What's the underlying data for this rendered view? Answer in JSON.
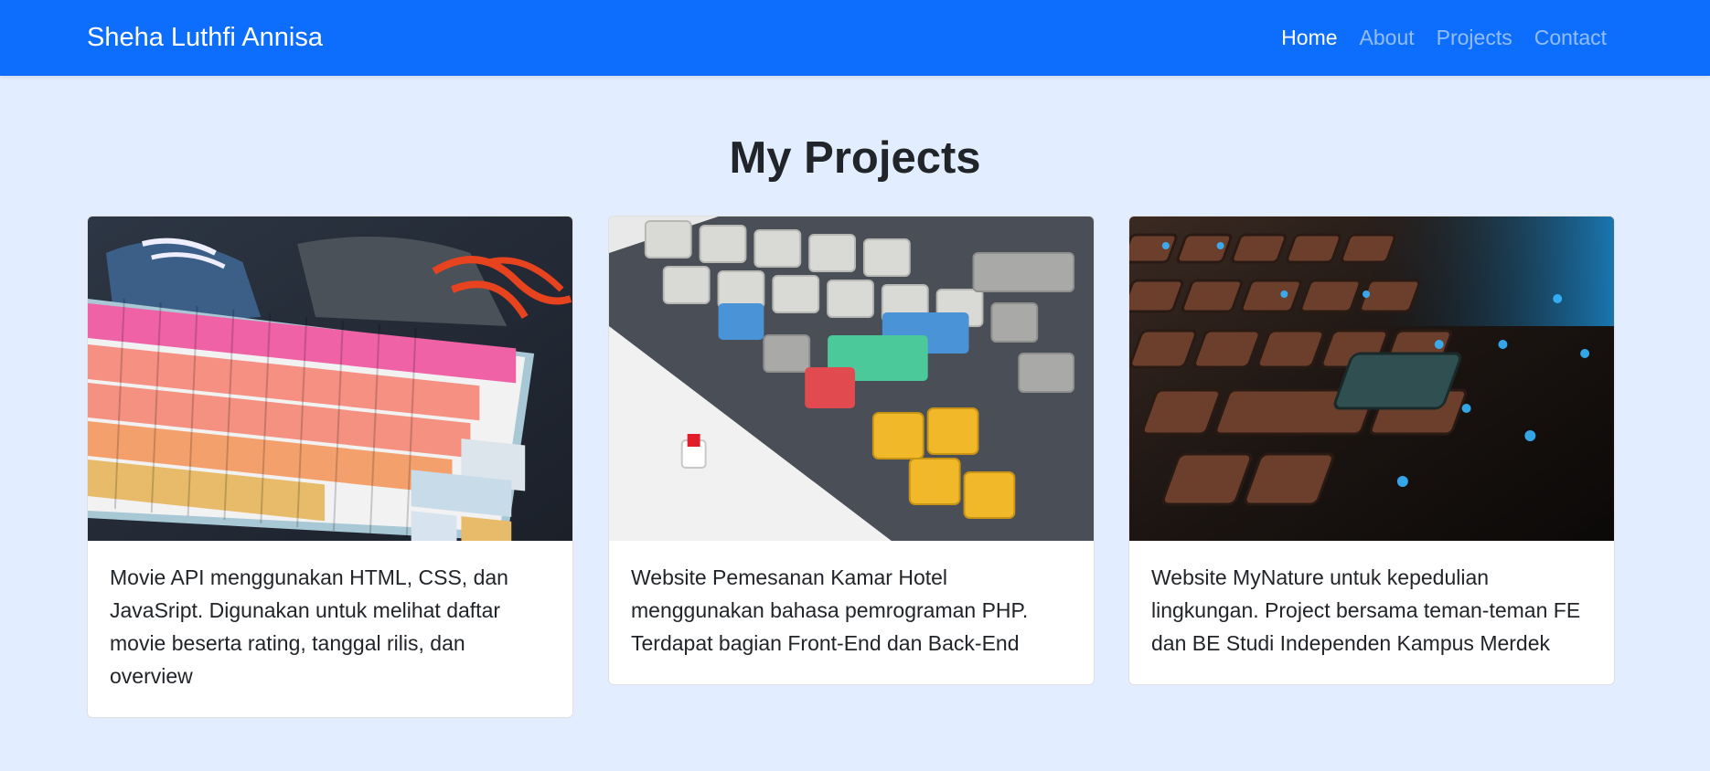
{
  "navbar": {
    "brand": "Sheha Luthfi Annisa",
    "links": [
      {
        "label": "Home",
        "active": true
      },
      {
        "label": "About",
        "active": false
      },
      {
        "label": "Projects",
        "active": false
      },
      {
        "label": "Contact",
        "active": false
      }
    ]
  },
  "main": {
    "title": "My Projects",
    "projects": [
      {
        "image": "pastel-keyboard-photo",
        "description": "Movie API menggunakan HTML, CSS, dan JavaSript. Digunakan untuk melihat daftar movie beserta rating, tanggal rilis, dan overview"
      },
      {
        "image": "mechanical-keyboard-photo",
        "description": "Website Pemesanan Kamar Hotel menggunakan bahasa pemrograman PHP. Terdapat bagian Front-End dan Back-End"
      },
      {
        "image": "backlit-keyboard-photo",
        "description": "Website MyNature untuk kepedulian lingkungan. Project bersama teman-teman FE dan BE Studi Independen Kampus Merdek"
      }
    ]
  },
  "colors": {
    "navbar": "#0d6efd",
    "page_background": "#e2edff",
    "text": "#212529"
  }
}
